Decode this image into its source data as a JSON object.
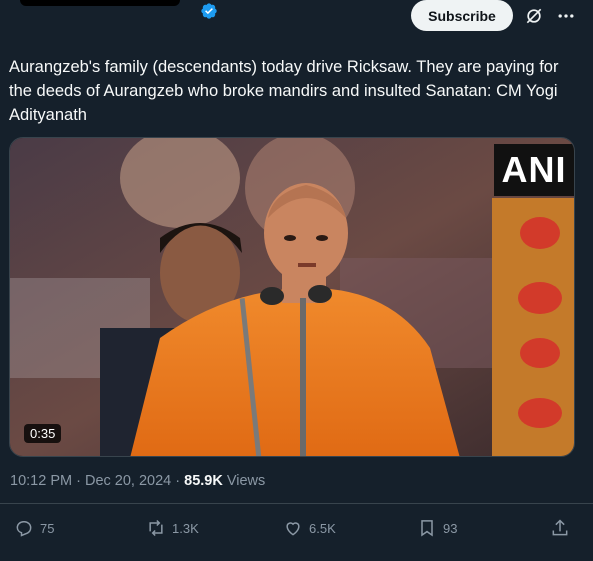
{
  "header": {
    "subscribe_label": "Subscribe",
    "icons": [
      "verified-badge-icon",
      "grok-icon",
      "more-icon"
    ]
  },
  "tweet": {
    "text": "Aurangzeb's family (descendants) today drive Ricksaw. They are paying for the deeds of Aurangzeb who broke mandirs and insulted Sanatan: CM Yogi Adityanath",
    "video": {
      "watermark": "ANI",
      "duration": "0:35"
    },
    "time": "10:12 PM",
    "separator": " · ",
    "date": "Dec 20, 2024",
    "views_count": "85.9K",
    "views_label": " Views"
  },
  "actions": {
    "replies": "75",
    "reposts": "1.3K",
    "likes": "6.5K",
    "bookmarks": "93"
  },
  "colors": {
    "background": "#15202b",
    "text": "#f7f9f9",
    "muted": "#8b98a5",
    "accent": "#1d9bf0"
  }
}
